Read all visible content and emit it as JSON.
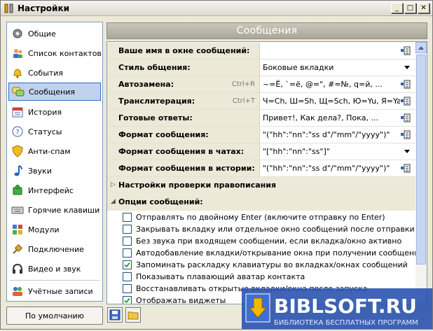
{
  "window": {
    "title": "Настройки"
  },
  "sidebar": {
    "items": [
      {
        "label": "Общие",
        "icon": "gear-icon"
      },
      {
        "label": "Список контактов",
        "icon": "contacts-icon"
      },
      {
        "label": "События",
        "icon": "bell-icon"
      },
      {
        "label": "Сообщения",
        "icon": "chat-icon"
      },
      {
        "label": "История",
        "icon": "calendar-icon"
      },
      {
        "label": "Статусы",
        "icon": "help-icon"
      },
      {
        "label": "Анти-спам",
        "icon": "shield-icon"
      },
      {
        "label": "Звуки",
        "icon": "music-note-icon"
      },
      {
        "label": "Интерфейс",
        "icon": "puzzle-icon"
      },
      {
        "label": "Горячие клавиши",
        "icon": "keyboard-icon"
      },
      {
        "label": "Модули",
        "icon": "modules-icon"
      },
      {
        "label": "Подключение",
        "icon": "plug-icon"
      },
      {
        "label": "Видео и звук",
        "icon": "headphones-icon"
      },
      {
        "label": "Учётные записи",
        "icon": "accounts-icon"
      }
    ],
    "active_index": 3
  },
  "default_button": "По умолчанию",
  "panel": {
    "title": "Сообщения",
    "properties": [
      {
        "name": "Ваше имя в окне сообщений:",
        "shortcut": "",
        "value": "",
        "control": "button"
      },
      {
        "name": "Стиль общения:",
        "shortcut": "",
        "value": "Боковые вкладки",
        "control": "dropdown"
      },
      {
        "name": "Автозамена:",
        "shortcut": "Ctrl+R",
        "value": "~=Ё, `=ё, @=\", #=№, q=й, ...",
        "control": "button"
      },
      {
        "name": "Транслитерация:",
        "shortcut": "Ctrl+T",
        "value": "Ч=Ch, Ш=Sh, Щ=Sch, Ю=Yu, Я=Ya, ...",
        "control": "button"
      },
      {
        "name": "Готовые ответы:",
        "shortcut": "",
        "value": "Привет!, Как дела?, Пока, ...",
        "control": "button"
      },
      {
        "name": "Формат сообщения:",
        "shortcut": "",
        "value": "\"(\"hh\":\"nn\":\"ss d\"/\"mm\"/\"yyyy\")\"",
        "control": "button"
      },
      {
        "name": "Формат сообщения в чатах:",
        "shortcut": "",
        "value": "\"[\"hh\":\"nn\":\"ss\"]\"",
        "control": "dropdown"
      },
      {
        "name": "Формат сообщения в истории:",
        "shortcut": "",
        "value": "\"(\"hh\":\"nn\":\"ss d\"/\"mm\"/\"yyyy\")\"",
        "control": "button"
      }
    ],
    "spellcheck_group": "Настройки проверки правописания",
    "options_group": "Опции сообщений:",
    "options": [
      {
        "label": "Отправлять по двойному Enter (включите отправку по Enter)",
        "checked": false
      },
      {
        "label": "Закрывать вкладку или отдельное окно сообщений после отправки",
        "checked": false
      },
      {
        "label": "Без звука при входящем сообщении, если вкладка/окно активно",
        "checked": false
      },
      {
        "label": "Автодобавление вкладки/открывание окна при получении сообщения",
        "checked": false
      },
      {
        "label": "Запоминать раскладку клавиатуры во вкладках/окнах сообщений",
        "checked": true
      },
      {
        "label": "Показывать плавающий аватар контакта",
        "checked": false
      },
      {
        "label": "Восстанавливать открытые вкладки/окна после запуска",
        "checked": false
      },
      {
        "label": "Отображать виджеты",
        "checked": true
      }
    ]
  },
  "watermark": {
    "brand": "BIBLSOFT.RU",
    "tagline": "БИБЛИОТЕКА БЕСПЛАТНЫХ ПРОГРАММ"
  },
  "colors": {
    "accent": "#316ac5",
    "selection": "#c1d2ee",
    "watermark_bg": "#2a53b0",
    "watermark_arrow": "#f2b800"
  }
}
